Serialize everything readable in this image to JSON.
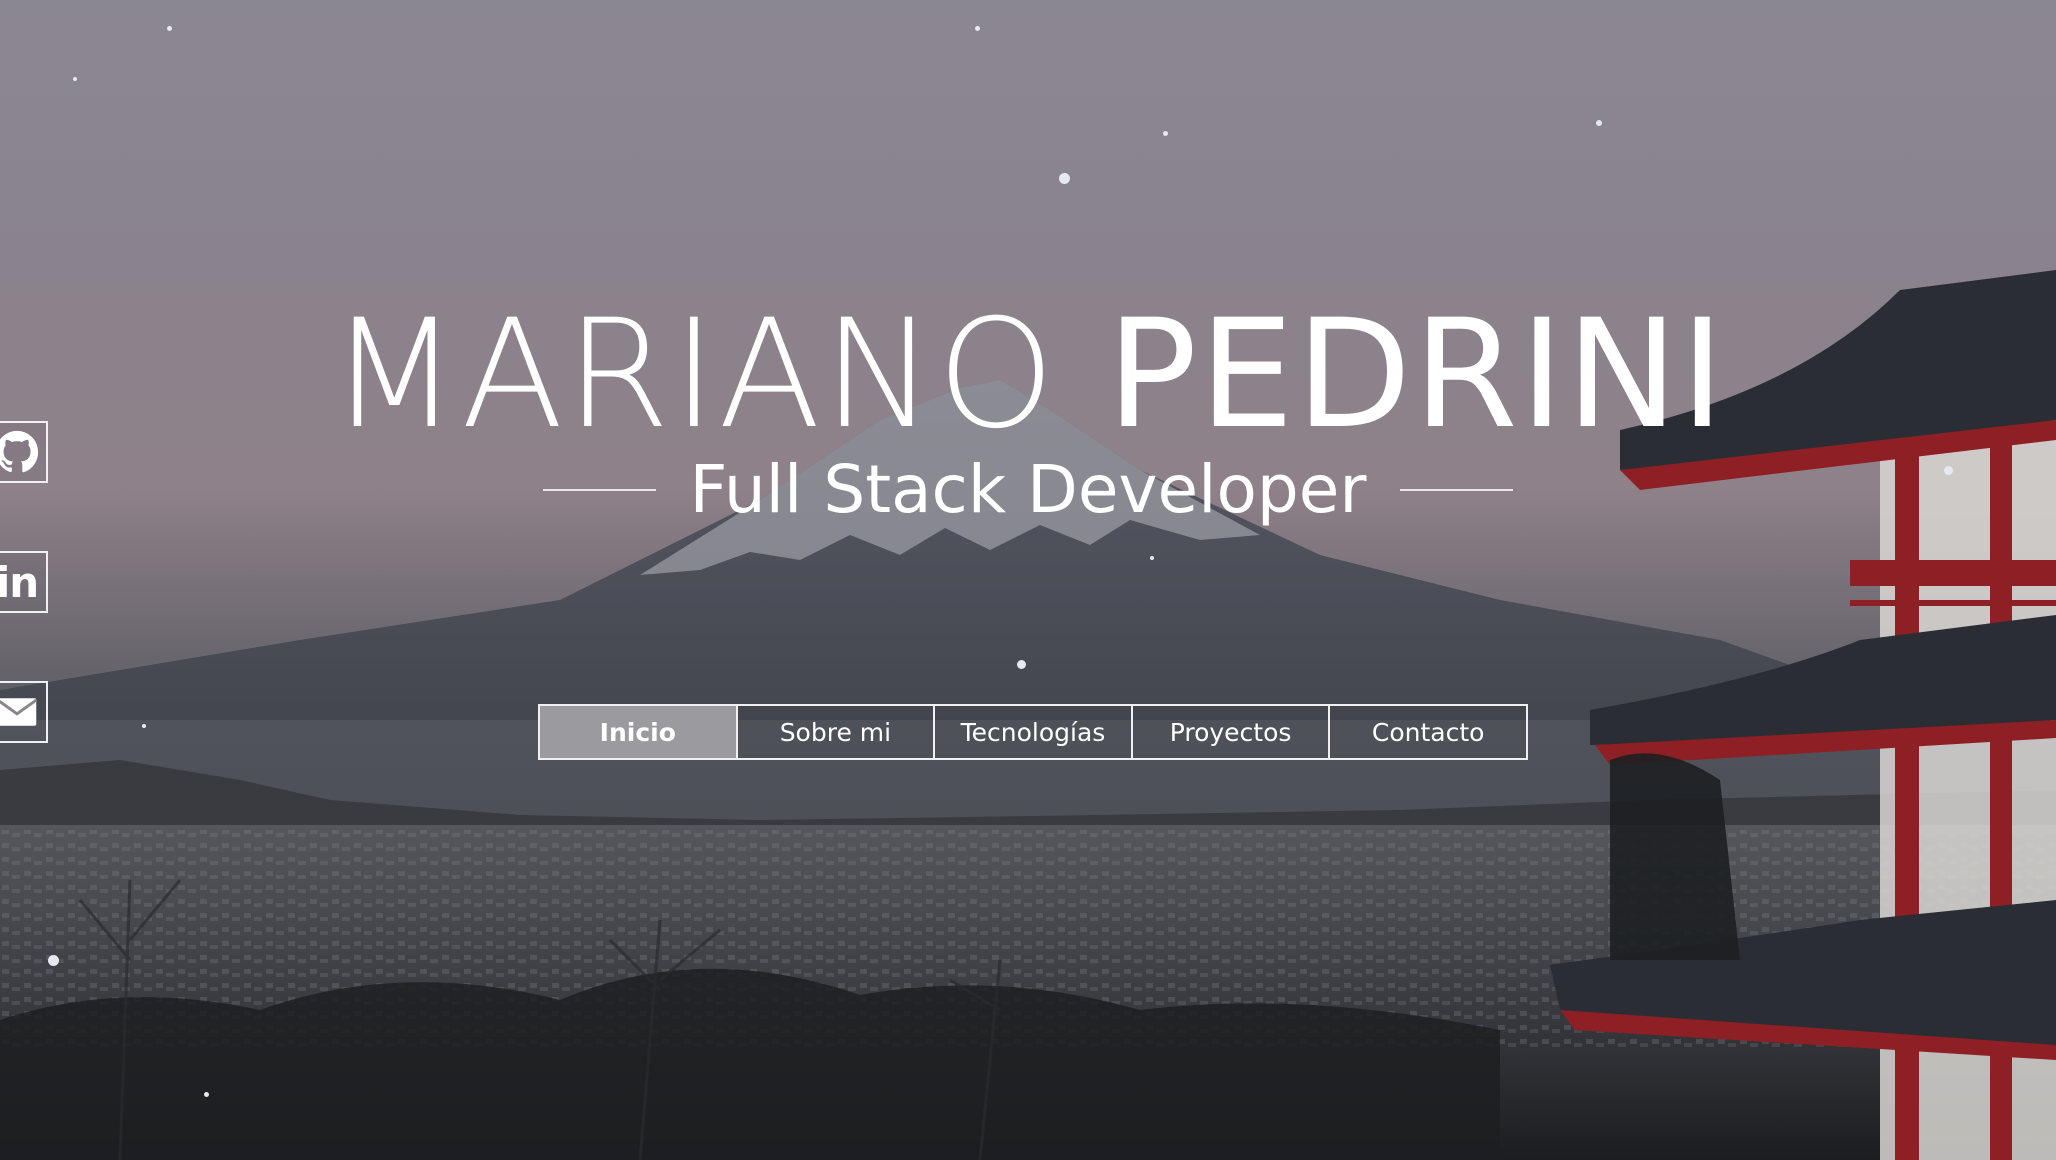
{
  "hero": {
    "name_first": "MARIANO",
    "name_last": "PEDRINI",
    "subtitle": "Full Stack Developer"
  },
  "nav": {
    "items": [
      {
        "label": "Inicio",
        "active": true
      },
      {
        "label": "Sobre mi",
        "active": false
      },
      {
        "label": "Tecnologías",
        "active": false
      },
      {
        "label": "Proyectos",
        "active": false
      },
      {
        "label": "Contacto",
        "active": false
      }
    ]
  },
  "social": {
    "github_icon": "github-icon",
    "linkedin_text": "in",
    "email_icon": "mail-icon"
  },
  "colors": {
    "text": "#ffffff",
    "nav_border": "#f0f0f2",
    "nav_active_bg": "#9b9a9f",
    "pagoda_red": "#8e1f24",
    "roof_dark": "#2a2d34"
  }
}
